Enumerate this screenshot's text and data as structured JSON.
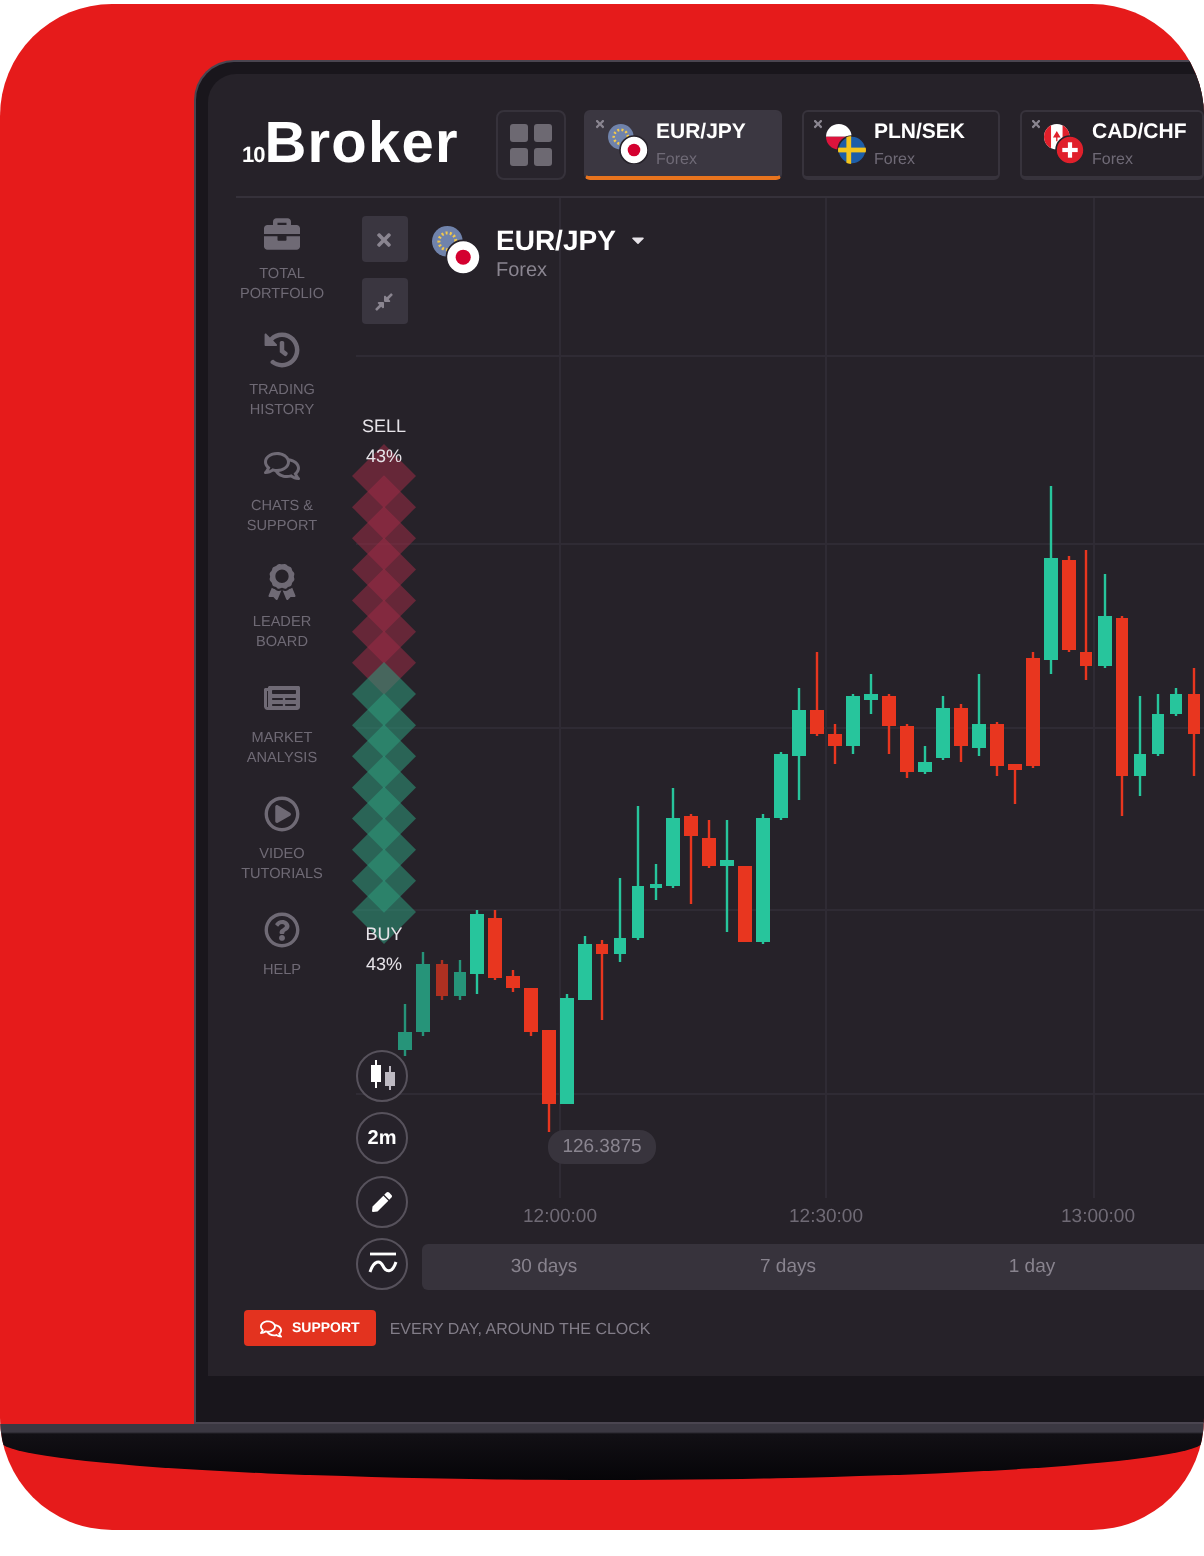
{
  "logo": {
    "mark": "10",
    "text": "Broker"
  },
  "tabs": [
    {
      "pair": "EUR/JPY",
      "market": "Forex",
      "selected": true
    },
    {
      "pair": "PLN/SEK",
      "market": "Forex",
      "selected": false
    },
    {
      "pair": "CAD/CHF",
      "market": "Forex",
      "selected": false
    }
  ],
  "sidebar": {
    "items": [
      {
        "label": "TOTAL PORTFOLIO"
      },
      {
        "label": "TRADING HISTORY"
      },
      {
        "label": "CHATS & SUPPORT"
      },
      {
        "label": "LEADER BOARD"
      },
      {
        "label": "MARKET ANALYSIS"
      },
      {
        "label": "VIDEO TUTORIALS"
      },
      {
        "label": "HELP"
      }
    ]
  },
  "asset": {
    "pair": "EUR/JPY",
    "market": "Forex"
  },
  "sentiment": {
    "sell_label": "SELL",
    "sell_reading": "43%",
    "buy_label": "BUY",
    "buy_reading": "43%",
    "level": 0.47
  },
  "chart": {
    "price_label": "126.3875",
    "time_labels": [
      "12:00:00",
      "12:30:00",
      "13:00:00"
    ],
    "timeframe": "2m"
  },
  "ranges": [
    {
      "label": "30 days"
    },
    {
      "label": "7 days"
    },
    {
      "label": "1 day"
    }
  ],
  "support": {
    "button": "SUPPORT",
    "note": "EVERY DAY, AROUND THE CLOCK"
  }
}
